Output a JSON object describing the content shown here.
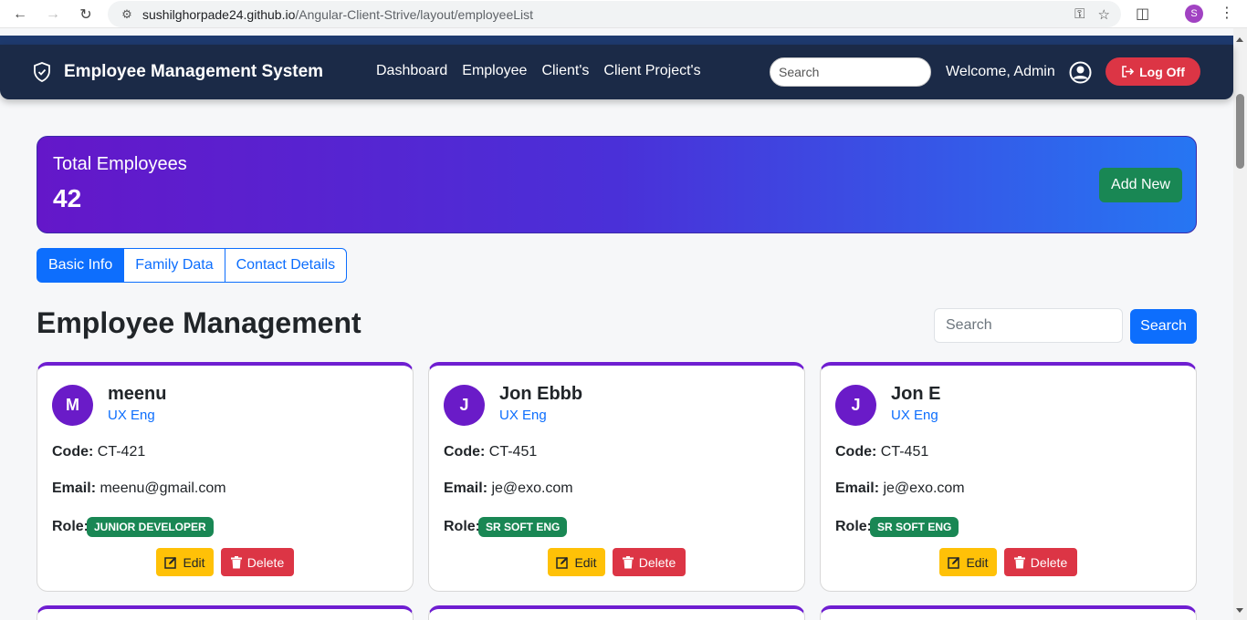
{
  "browser": {
    "url_host": "sushilghorpade24.github.io",
    "url_path": "/Angular-Client-Strive/layout/employeeList",
    "profile_initial": "S",
    "icons": [
      "back-arrow-icon",
      "forward-arrow-icon",
      "reload-icon",
      "site-settings-icon",
      "key-icon",
      "star-icon",
      "extensions-icon",
      "kebab-menu-icon"
    ]
  },
  "navbar": {
    "brand": "Employee Management System",
    "links": [
      "Dashboard",
      "Employee",
      "Client's",
      "Client Project's"
    ],
    "search_placeholder": "Search",
    "welcome": "Welcome, Admin",
    "logoff_label": "Log Off",
    "bg_color": "#1b2a47"
  },
  "summary": {
    "label": "Total Employees",
    "count": "42",
    "add_new_label": "Add New"
  },
  "tabs": [
    {
      "label": "Basic Info",
      "active": true
    },
    {
      "label": "Family Data",
      "active": false
    },
    {
      "label": "Contact Details",
      "active": false
    }
  ],
  "main": {
    "title": "Employee Management",
    "search_placeholder": "Search",
    "search_button": "Search"
  },
  "card_labels": {
    "code": "Code:",
    "email": "Email:",
    "role": "Role:",
    "edit": "Edit",
    "delete": "Delete"
  },
  "employees": [
    {
      "initial": "M",
      "name": "meenu",
      "designation": "UX Eng",
      "code": "CT-421",
      "email": "meenu@gmail.com",
      "role": "JUNIOR DEVELOPER"
    },
    {
      "initial": "J",
      "name": "Jon Ebbb",
      "designation": "UX Eng",
      "code": "CT-451",
      "email": "je@exo.com",
      "role": "SR SOFT ENG"
    },
    {
      "initial": "J",
      "name": "Jon E",
      "designation": "UX Eng",
      "code": "CT-451",
      "email": "je@exo.com",
      "role": "SR SOFT ENG"
    }
  ],
  "colors": {
    "primary": "#0d6efd",
    "success": "#198754",
    "danger": "#dc3545",
    "warning": "#ffc107",
    "accent_purple": "#6f1ed1"
  }
}
